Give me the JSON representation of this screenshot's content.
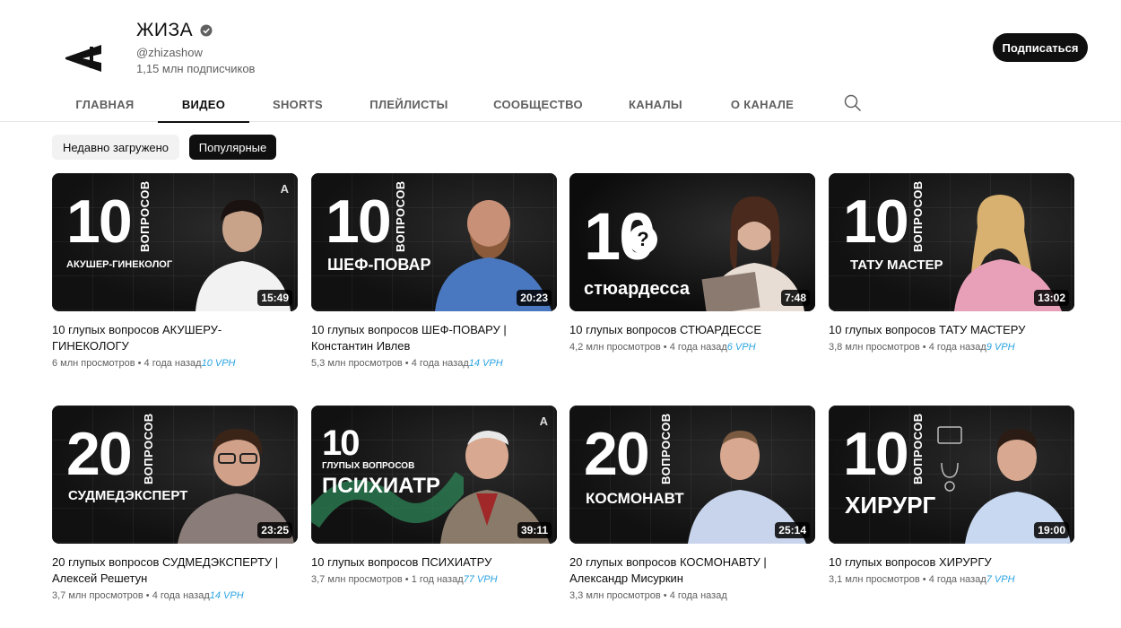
{
  "channel": {
    "name": "ЖИЗА",
    "handle": "@zhizashow",
    "subscribers": "1,15 млн подписчиков",
    "logo_icon": "zhiza-logo-icon",
    "verified_icon": "verified-check-icon",
    "subscribe_label": "Подписаться"
  },
  "tabs": [
    {
      "label": "ГЛАВНАЯ",
      "active": false
    },
    {
      "label": "ВИДЕО",
      "active": true
    },
    {
      "label": "SHORTS",
      "active": false
    },
    {
      "label": "ПЛЕЙЛИСТЫ",
      "active": false
    },
    {
      "label": "СООБЩЕСТВО",
      "active": false
    },
    {
      "label": "КАНАЛЫ",
      "active": false
    },
    {
      "label": "О КАНАЛЕ",
      "active": false
    }
  ],
  "search_icon": "search-icon",
  "filters": {
    "recent": "Недавно загружено",
    "popular": "Популярные",
    "selected": "popular"
  },
  "videos": [
    {
      "title": "10 глупых вопросов АКУШЕРУ-ГИНЕКОЛОГУ",
      "views": "6 млн просмотров",
      "age": "4 года назад",
      "vph": "10 VPH",
      "duration": "15:49",
      "thumb_number": "10",
      "thumb_vertical": "ВОПРОСОВ",
      "thumb_label": "АКУШЕР-ГИНЕКОЛОГ",
      "brand_mark": "A"
    },
    {
      "title": "10 глупых вопросов ШЕФ-ПОВАРУ | Константин Ивлев",
      "views": "5,3 млн просмотров",
      "age": "4 года назад",
      "vph": "14 VPH",
      "duration": "20:23",
      "thumb_number": "10",
      "thumb_vertical": "ВОПРОСОВ",
      "thumb_label": "ШЕФ-ПОВАР",
      "brand_mark": ""
    },
    {
      "title": "10 глупых вопросов СТЮАРДЕССЕ",
      "views": "4,2 млн просмотров",
      "age": "4 года назад",
      "vph": "6 VPH",
      "duration": "7:48",
      "thumb_number": "10",
      "thumb_vertical": "",
      "thumb_label": "стюардесса",
      "brand_mark": ""
    },
    {
      "title": "10 глупых вопросов ТАТУ МАСТЕРУ",
      "views": "3,8 млн просмотров",
      "age": "4 года назад",
      "vph": "9 VPH",
      "duration": "13:02",
      "thumb_number": "10",
      "thumb_vertical": "ВОПРОСОВ",
      "thumb_label": "ТАТУ МАСТЕР",
      "brand_mark": ""
    },
    {
      "title": "20 глупых вопросов СУДМЕДЭКСПЕРТУ | Алексей Решетун",
      "views": "3,7 млн просмотров",
      "age": "4 года назад",
      "vph": "14 VPH",
      "duration": "23:25",
      "thumb_number": "20",
      "thumb_vertical": "ВОПРОСОВ",
      "thumb_label": "СУДМЕДЭКСПЕРТ",
      "brand_mark": ""
    },
    {
      "title": "10 глупых вопросов ПСИХИАТРУ",
      "views": "3,7 млн просмотров",
      "age": "1 год назад",
      "vph": "77 VPH",
      "duration": "39:11",
      "thumb_number": "10",
      "thumb_vertical": "ГЛУПЫХ ВОПРОСОВ",
      "thumb_label": "ПСИХИАТР",
      "brand_mark": "A"
    },
    {
      "title": "20 глупых вопросов КОСМОНАВТУ | Александр Мисуркин",
      "views": "3,3 млн просмотров",
      "age": "4 года назад",
      "vph": "",
      "duration": "25:14",
      "thumb_number": "20",
      "thumb_vertical": "ВОПРОСОВ",
      "thumb_label": "КОСМОНАВТ",
      "brand_mark": ""
    },
    {
      "title": "10 глупых вопросов ХИРУРГУ",
      "views": "3,1 млн просмотров",
      "age": "4 года назад",
      "vph": "7 VPH",
      "duration": "19:00",
      "thumb_number": "10",
      "thumb_vertical": "ВОПРОСОВ",
      "thumb_label": "ХИРУРГ",
      "brand_mark": ""
    }
  ],
  "colors": {
    "accent": "#0f0f0f",
    "vph": "#2aa3e0",
    "meta": "#606060"
  }
}
